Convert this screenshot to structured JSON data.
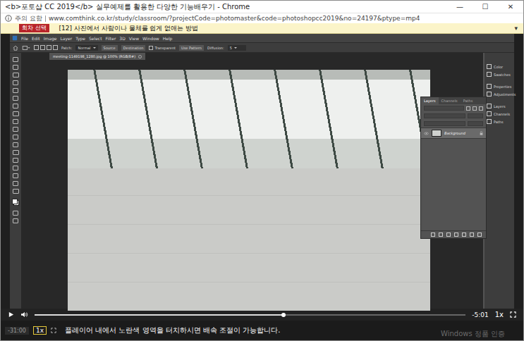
{
  "window": {
    "title": "<b>포토샵 CC 2019</b> 실무예제를 활용한 다양한 기능배우기 - Chrome",
    "controls": [
      "—",
      "☐",
      "✕"
    ]
  },
  "address_bar": {
    "security": "주의 요함",
    "url": "www.comthink.co.kr/study/classroom/?projectCode=photomaster&code=photoshopcc2019&no=24197&ptype=mp4"
  },
  "episode_bar": {
    "button": "회차 선택",
    "title": "[12] 사진에서 사람이나 물체를 쉽게 없애는 방법",
    "dropdown": "▾"
  },
  "photoshop": {
    "menu": [
      "File",
      "Edit",
      "Image",
      "Layer",
      "Type",
      "Select",
      "Filter",
      "3D",
      "View",
      "Window",
      "Help"
    ],
    "options": [
      {
        "label": "Patch:",
        "kind": "label"
      },
      {
        "label": "Normal",
        "kind": "select"
      },
      {
        "label": "Source",
        "kind": "button"
      },
      {
        "label": "Destination",
        "kind": "button"
      },
      {
        "label": "Transparent",
        "kind": "checkbox"
      },
      {
        "label": "Use Pattern",
        "kind": "button"
      },
      {
        "label": "Diffusion:",
        "kind": "label"
      },
      {
        "label": "5",
        "kind": "select"
      }
    ],
    "document_tab": "meeting-1149198_1280.jpg @ 100% (RGB/8#)",
    "panel_tabs": [
      {
        "label": "Layers",
        "selected": true
      },
      {
        "label": "Channels",
        "selected": false
      },
      {
        "label": "Paths",
        "selected": false
      }
    ],
    "layers": [
      {
        "name": "Background",
        "selected": true
      }
    ],
    "side_panels": [
      "Color",
      "Swatches",
      "Properties",
      "Adjustments",
      "Layers",
      "Channels",
      "Paths"
    ]
  },
  "player": {
    "progress": {
      "level": 0.577
    },
    "remaining": "-5:01",
    "speed": "1x"
  },
  "bottom_bar": {
    "elapsed": "-31:00",
    "speed": "1x",
    "notice": "플레이어 내에서 노란색 영역을 터치하시면 배속 조절이 가능합니다."
  },
  "watermark": "Windows 정품 인증"
}
